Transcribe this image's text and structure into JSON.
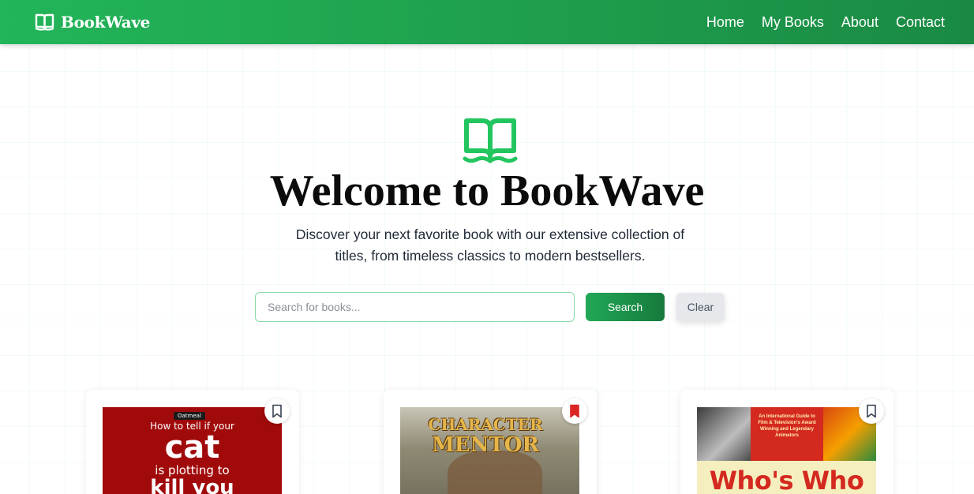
{
  "navbar": {
    "brand": "BookWave",
    "links": [
      "Home",
      "My Books",
      "About",
      "Contact"
    ]
  },
  "hero": {
    "title": "Welcome to BookWave",
    "subtitle": "Discover your next favorite book with our extensive collection of titles, from timeless classics to modern bestsellers."
  },
  "search": {
    "placeholder": "Search for books...",
    "value": "",
    "search_label": "Search",
    "clear_label": "Clear"
  },
  "books": [
    {
      "cover_lines": [
        "How to tell if your",
        "cat",
        "is plotting to",
        "kill you"
      ],
      "publisher": "Oatmeal",
      "bookmarked": false
    },
    {
      "cover_lines": [
        "CHARACTER",
        "MENTOR"
      ],
      "bookmarked": true
    },
    {
      "cover_lines": [
        "An International Guide to Film & Television's Award Winning and Legendary Animators",
        "Who's Who"
      ],
      "bookmarked": false
    }
  ],
  "colors": {
    "primary": "#22b559",
    "primary_dark": "#177a3d",
    "bookmark_active": "#dc2626"
  },
  "icons": {
    "brand": "book-open-icon",
    "hero": "book-open-wave-icon",
    "bookmark": "bookmark-icon"
  }
}
